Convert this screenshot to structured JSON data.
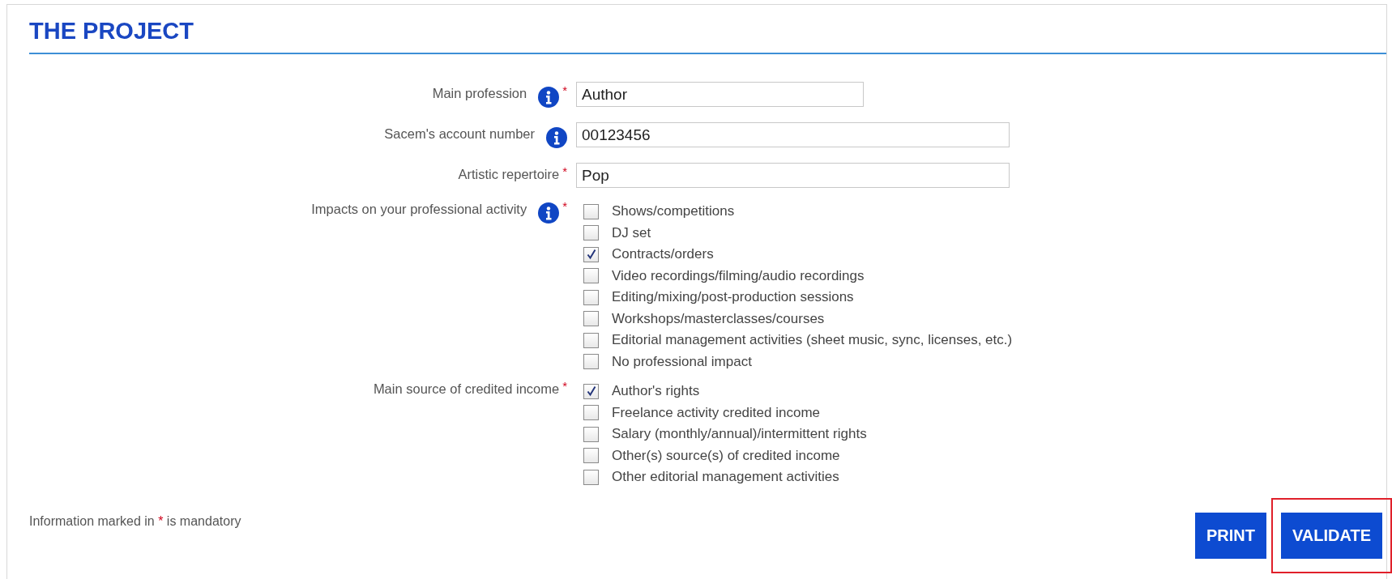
{
  "title": "THE PROJECT",
  "fields": [
    {
      "kind": "text",
      "label": "Main profession",
      "info": true,
      "required": true,
      "value": "Author"
    },
    {
      "kind": "text",
      "label": "Sacem's account number",
      "info": true,
      "required": false,
      "value": "00123456"
    },
    {
      "kind": "text",
      "label": "Artistic repertoire",
      "info": false,
      "required": true,
      "value": "Pop"
    },
    {
      "kind": "checklist",
      "label": "Impacts on your professional activity",
      "info": true,
      "required": true,
      "options": [
        {
          "label": "Shows/competitions",
          "checked": false
        },
        {
          "label": "DJ set",
          "checked": false
        },
        {
          "label": "Contracts/orders",
          "checked": true
        },
        {
          "label": "Video recordings/filming/audio recordings",
          "checked": false
        },
        {
          "label": "Editing/mixing/post-production sessions",
          "checked": false
        },
        {
          "label": "Workshops/masterclasses/courses",
          "checked": false
        },
        {
          "label": "Editorial management activities (sheet music, sync, licenses, etc.)",
          "checked": false
        },
        {
          "label": "No professional impact",
          "checked": false
        }
      ]
    },
    {
      "kind": "checklist",
      "label": "Main source of credited income",
      "info": false,
      "required": true,
      "options": [
        {
          "label": "Author's rights",
          "checked": true
        },
        {
          "label": "Freelance activity credited income",
          "checked": false
        },
        {
          "label": "Salary (monthly/annual)/intermittent rights",
          "checked": false
        },
        {
          "label": "Other(s) source(s) of credited income",
          "checked": false
        },
        {
          "label": "Other editorial management activities",
          "checked": false
        }
      ]
    }
  ],
  "mandatory_note": {
    "before": "Information marked in ",
    "mark": "*",
    "after": " is mandatory"
  },
  "buttons": [
    {
      "label": "PRINT",
      "highlighted": false
    },
    {
      "label": "VALIDATE",
      "highlighted": true
    }
  ]
}
